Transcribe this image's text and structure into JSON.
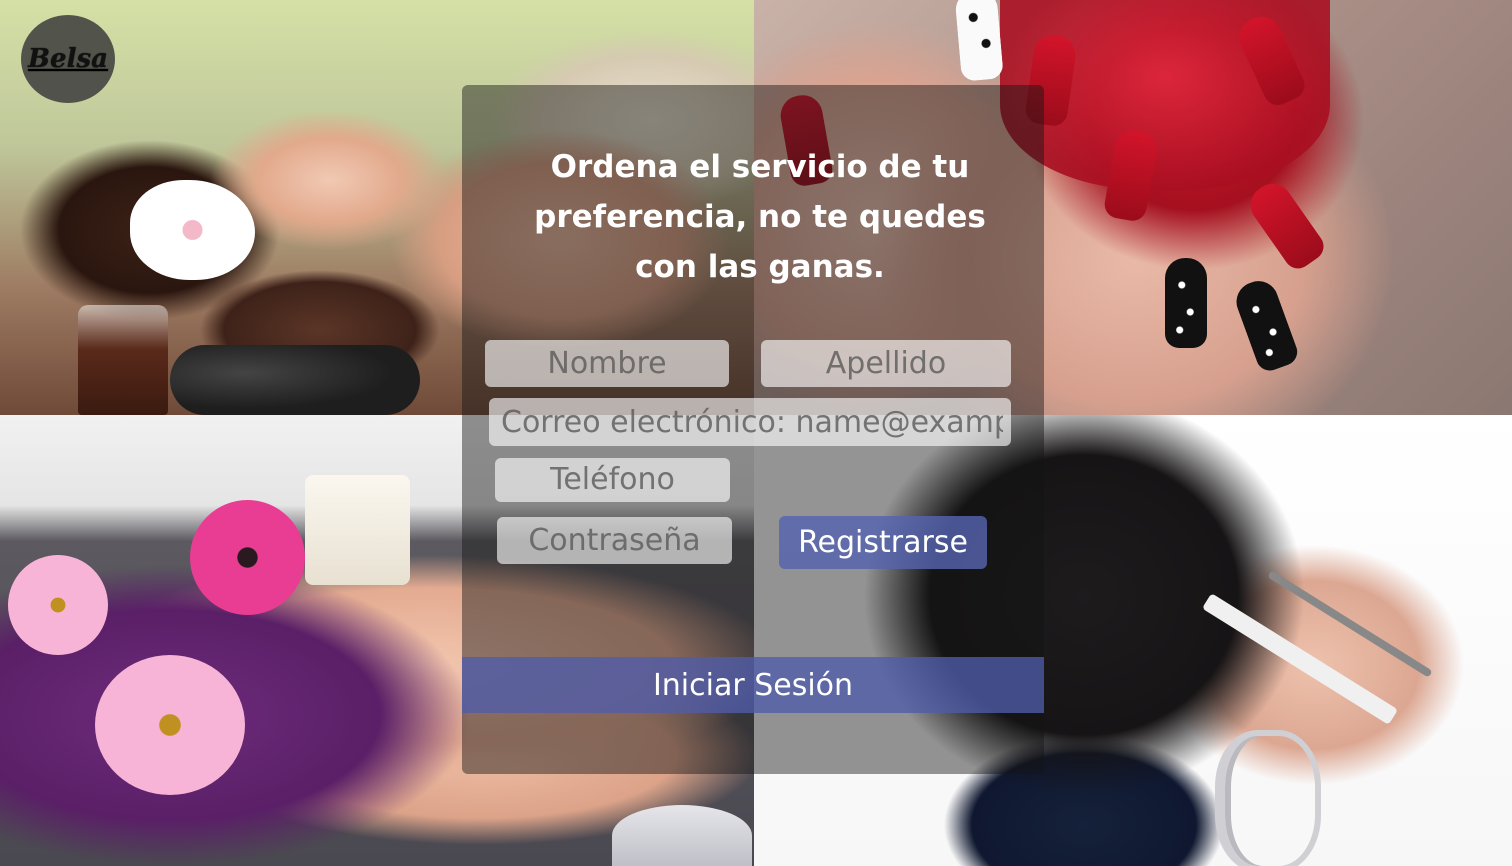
{
  "logo": {
    "text": "Belsa"
  },
  "form": {
    "headline": "Ordena  el servicio de tu\npreferencia, no te quedes\ncon las ganas.",
    "fields": {
      "nombre": {
        "placeholder": "Nombre"
      },
      "apellido": {
        "placeholder": "Apellido"
      },
      "correo": {
        "placeholder": "Correo electrónico: name@example.com"
      },
      "telefono": {
        "placeholder": "Teléfono"
      },
      "contrasena": {
        "placeholder": "Contraseña"
      }
    },
    "register_label": "Registrarse",
    "login_label": "Iniciar Sesión"
  },
  "background": {
    "images": [
      "spa-massage-photo",
      "red-manicure-photo",
      "pedicure-photo",
      "haircut-photo"
    ]
  },
  "colors": {
    "panel_overlay": "#141414",
    "button_accent": "#5564AF",
    "input_fill": "#FFFFFF",
    "headline_text": "#FFFFFF"
  }
}
